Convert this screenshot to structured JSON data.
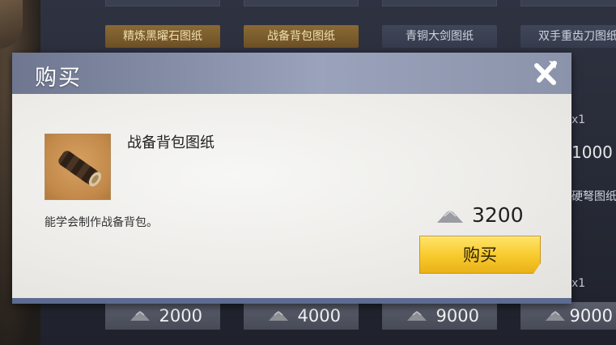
{
  "background": {
    "top_tags": [
      {
        "label": "精炼黑曜石图纸",
        "style": "gold"
      },
      {
        "label": "战备背包图纸",
        "style": "gold"
      },
      {
        "label": "青铜大剑图纸",
        "style": "slate"
      },
      {
        "label": "双手重齿刀图纸",
        "style": "slate"
      }
    ],
    "bottom_prices": [
      "2000",
      "4000",
      "9000",
      "9000"
    ],
    "right_peek": {
      "count_top": "x1",
      "price": "1000",
      "tag_partial": "硬弩图纸",
      "count_bottom": "x1"
    }
  },
  "dialog": {
    "title": "购买",
    "item": {
      "name": "战备背包图纸",
      "description": "能学会制作战备背包。"
    },
    "price": "3200",
    "buy_label": "购买"
  },
  "colors": {
    "gold_button": "#f7c92b",
    "header": "#8b93ab",
    "body": "#efeeeb"
  },
  "icons": {
    "close": "close-icon",
    "currency": "silver-pile-icon"
  }
}
